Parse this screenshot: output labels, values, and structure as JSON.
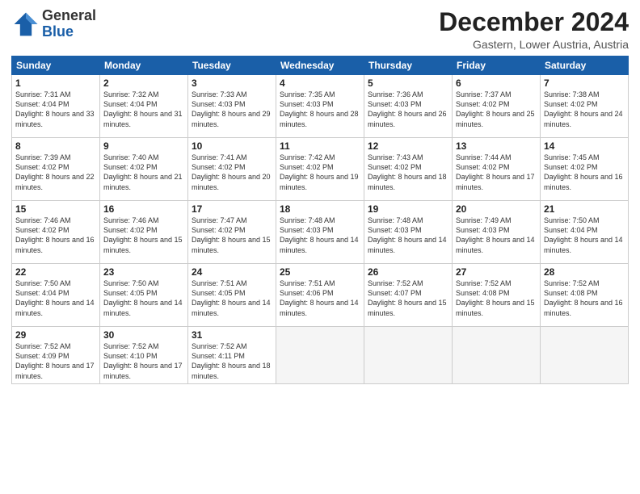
{
  "logo": {
    "general": "General",
    "blue": "Blue"
  },
  "title": "December 2024",
  "location": "Gastern, Lower Austria, Austria",
  "days_of_week": [
    "Sunday",
    "Monday",
    "Tuesday",
    "Wednesday",
    "Thursday",
    "Friday",
    "Saturday"
  ],
  "weeks": [
    [
      {
        "num": "1",
        "sunrise": "7:31 AM",
        "sunset": "4:04 PM",
        "daylight": "8 hours and 33 minutes."
      },
      {
        "num": "2",
        "sunrise": "7:32 AM",
        "sunset": "4:04 PM",
        "daylight": "8 hours and 31 minutes."
      },
      {
        "num": "3",
        "sunrise": "7:33 AM",
        "sunset": "4:03 PM",
        "daylight": "8 hours and 29 minutes."
      },
      {
        "num": "4",
        "sunrise": "7:35 AM",
        "sunset": "4:03 PM",
        "daylight": "8 hours and 28 minutes."
      },
      {
        "num": "5",
        "sunrise": "7:36 AM",
        "sunset": "4:03 PM",
        "daylight": "8 hours and 26 minutes."
      },
      {
        "num": "6",
        "sunrise": "7:37 AM",
        "sunset": "4:02 PM",
        "daylight": "8 hours and 25 minutes."
      },
      {
        "num": "7",
        "sunrise": "7:38 AM",
        "sunset": "4:02 PM",
        "daylight": "8 hours and 24 minutes."
      }
    ],
    [
      {
        "num": "8",
        "sunrise": "7:39 AM",
        "sunset": "4:02 PM",
        "daylight": "8 hours and 22 minutes."
      },
      {
        "num": "9",
        "sunrise": "7:40 AM",
        "sunset": "4:02 PM",
        "daylight": "8 hours and 21 minutes."
      },
      {
        "num": "10",
        "sunrise": "7:41 AM",
        "sunset": "4:02 PM",
        "daylight": "8 hours and 20 minutes."
      },
      {
        "num": "11",
        "sunrise": "7:42 AM",
        "sunset": "4:02 PM",
        "daylight": "8 hours and 19 minutes."
      },
      {
        "num": "12",
        "sunrise": "7:43 AM",
        "sunset": "4:02 PM",
        "daylight": "8 hours and 18 minutes."
      },
      {
        "num": "13",
        "sunrise": "7:44 AM",
        "sunset": "4:02 PM",
        "daylight": "8 hours and 17 minutes."
      },
      {
        "num": "14",
        "sunrise": "7:45 AM",
        "sunset": "4:02 PM",
        "daylight": "8 hours and 16 minutes."
      }
    ],
    [
      {
        "num": "15",
        "sunrise": "7:46 AM",
        "sunset": "4:02 PM",
        "daylight": "8 hours and 16 minutes."
      },
      {
        "num": "16",
        "sunrise": "7:46 AM",
        "sunset": "4:02 PM",
        "daylight": "8 hours and 15 minutes."
      },
      {
        "num": "17",
        "sunrise": "7:47 AM",
        "sunset": "4:02 PM",
        "daylight": "8 hours and 15 minutes."
      },
      {
        "num": "18",
        "sunrise": "7:48 AM",
        "sunset": "4:03 PM",
        "daylight": "8 hours and 14 minutes."
      },
      {
        "num": "19",
        "sunrise": "7:48 AM",
        "sunset": "4:03 PM",
        "daylight": "8 hours and 14 minutes."
      },
      {
        "num": "20",
        "sunrise": "7:49 AM",
        "sunset": "4:03 PM",
        "daylight": "8 hours and 14 minutes."
      },
      {
        "num": "21",
        "sunrise": "7:50 AM",
        "sunset": "4:04 PM",
        "daylight": "8 hours and 14 minutes."
      }
    ],
    [
      {
        "num": "22",
        "sunrise": "7:50 AM",
        "sunset": "4:04 PM",
        "daylight": "8 hours and 14 minutes."
      },
      {
        "num": "23",
        "sunrise": "7:50 AM",
        "sunset": "4:05 PM",
        "daylight": "8 hours and 14 minutes."
      },
      {
        "num": "24",
        "sunrise": "7:51 AM",
        "sunset": "4:05 PM",
        "daylight": "8 hours and 14 minutes."
      },
      {
        "num": "25",
        "sunrise": "7:51 AM",
        "sunset": "4:06 PM",
        "daylight": "8 hours and 14 minutes."
      },
      {
        "num": "26",
        "sunrise": "7:52 AM",
        "sunset": "4:07 PM",
        "daylight": "8 hours and 15 minutes."
      },
      {
        "num": "27",
        "sunrise": "7:52 AM",
        "sunset": "4:08 PM",
        "daylight": "8 hours and 15 minutes."
      },
      {
        "num": "28",
        "sunrise": "7:52 AM",
        "sunset": "4:08 PM",
        "daylight": "8 hours and 16 minutes."
      }
    ],
    [
      {
        "num": "29",
        "sunrise": "7:52 AM",
        "sunset": "4:09 PM",
        "daylight": "8 hours and 17 minutes."
      },
      {
        "num": "30",
        "sunrise": "7:52 AM",
        "sunset": "4:10 PM",
        "daylight": "8 hours and 17 minutes."
      },
      {
        "num": "31",
        "sunrise": "7:52 AM",
        "sunset": "4:11 PM",
        "daylight": "8 hours and 18 minutes."
      },
      null,
      null,
      null,
      null
    ]
  ]
}
